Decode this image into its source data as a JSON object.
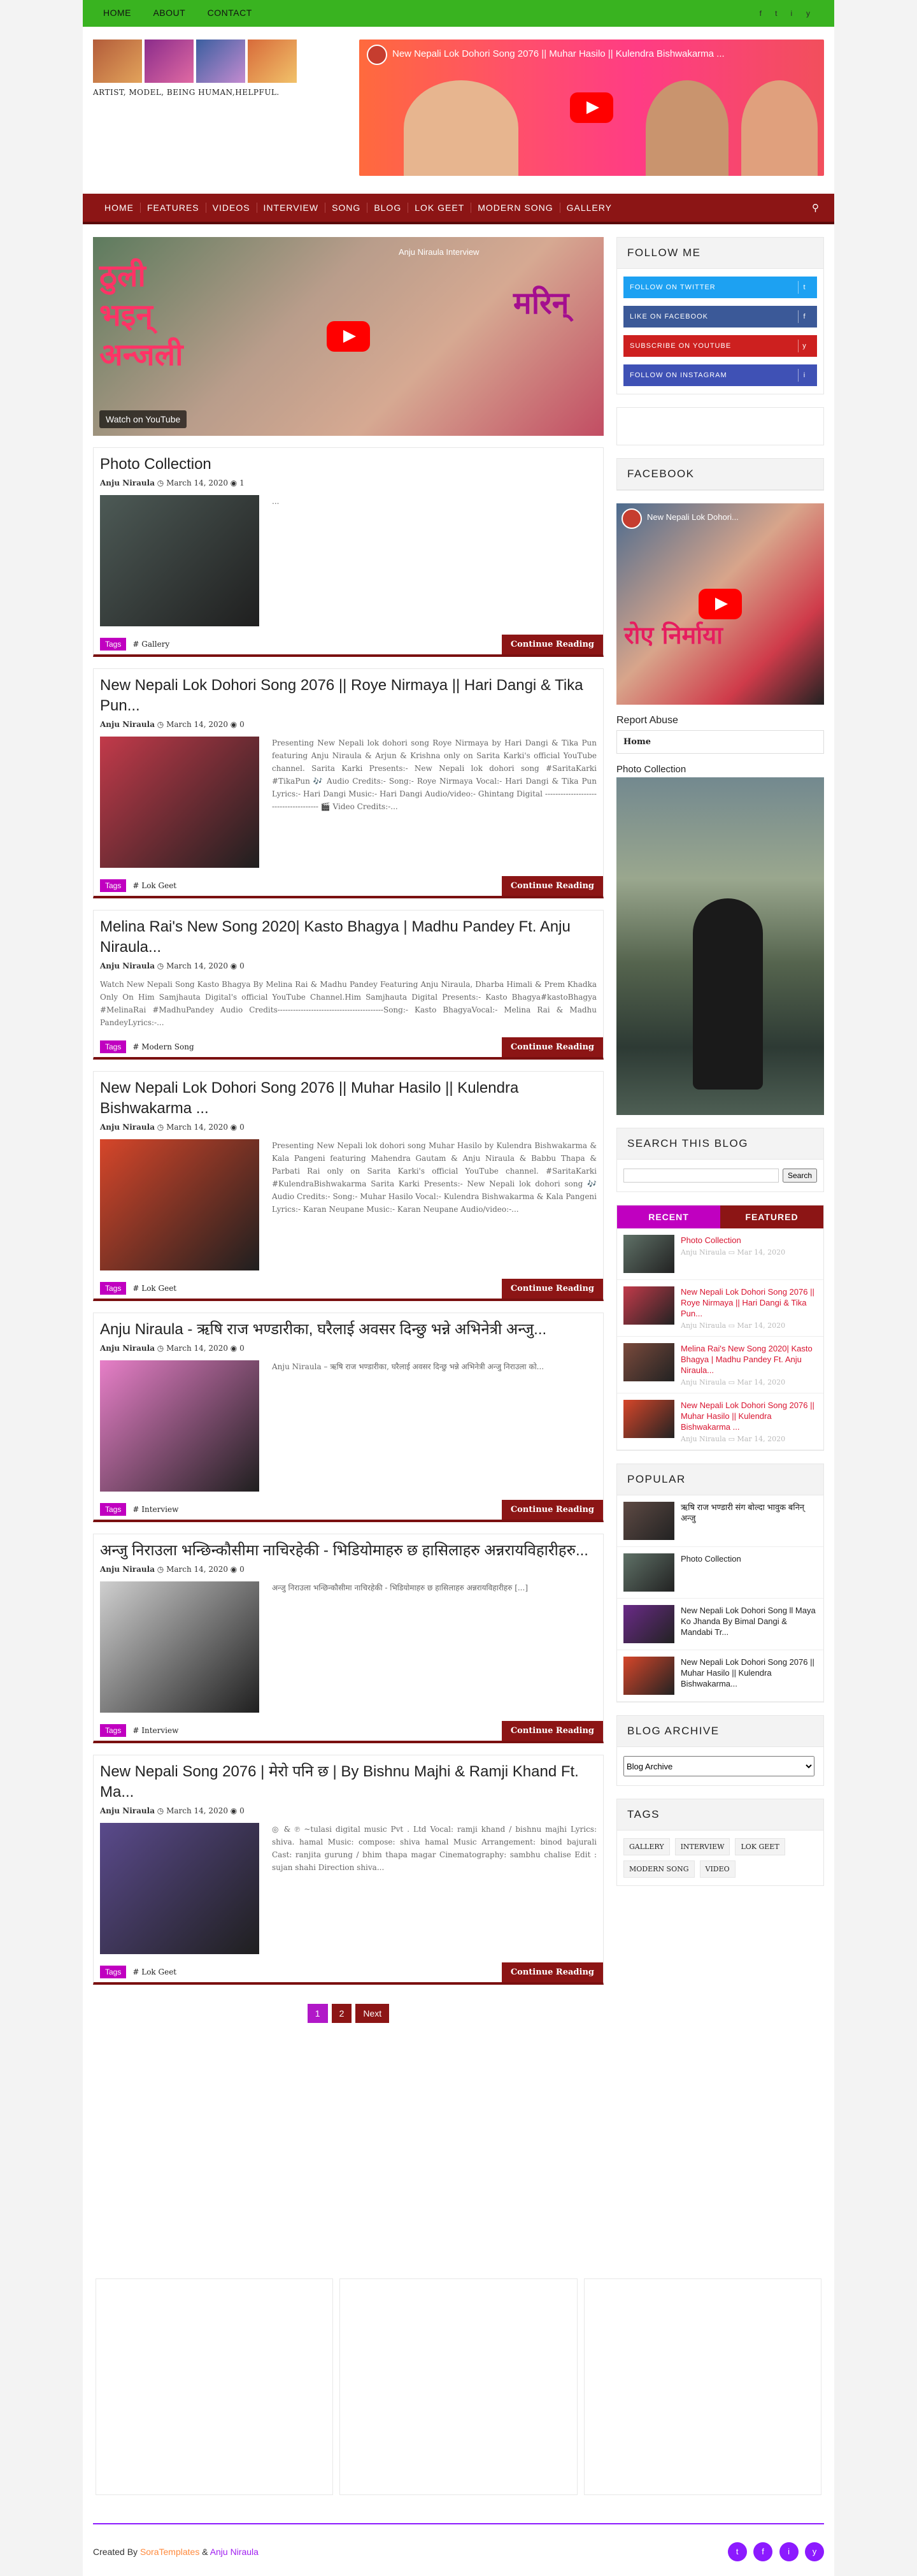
{
  "topnav": {
    "items": [
      "HOME",
      "ABOUT",
      "CONTACT"
    ],
    "social": [
      "f",
      "t",
      "i",
      "y"
    ]
  },
  "header": {
    "tagline": "ARTIST, MODEL, BEING HUMAN,HELPFUL.",
    "video_title": "New Nepali Lok Dohori Song 2076 || Muhar Hasilo || Kulendra Bishwakarma ..."
  },
  "nav": {
    "items": [
      "HOME",
      "FEATURES",
      "VIDEOS",
      "INTERVIEW",
      "SONG",
      "BLOG",
      "LOK GEET",
      "MODERN SONG",
      "GALLERY"
    ]
  },
  "featured": {
    "title": "Anju Niraula Interview",
    "watch": "Watch on  YouTube",
    "text_left": "ठुली भइन् अन्जली",
    "text_right": "मरिन्"
  },
  "posts": [
    {
      "title": "Photo Collection",
      "author": "Anju Niraula",
      "date": "March 14, 2020",
      "comments": "1",
      "snippet": "...",
      "tag": "# Gallery",
      "thumb": "#4d5a56"
    },
    {
      "title": "New Nepali Lok Dohori Song 2076 || Roye Nirmaya || Hari Dangi & Tika Pun...",
      "author": "Anju Niraula",
      "date": "March 14, 2020",
      "comments": "0",
      "snippet": "Presenting New Nepali lok dohori song Roye Nirmaya by Hari Dangi & Tika Pun featuring Anju Niraula & Arjun & Krishna only on Sarita Karki's official YouTube channel. Sarita Karki Presents:- New Nepali lok dohori song #SaritaKarki #TikaPun 🎶 Audio Credits:- Song:- Roye Nirmaya Vocal:- Hari Dangi & Tika Pun Lyrics:- Hari Dangi Music:- Hari Dangi Audio/video:- Ghintang Digital -------------------------------------- 🎬 Video Credits:-...",
      "tag": "# Lok Geet",
      "thumb": "#c23a4a"
    },
    {
      "title": "Melina Rai's New Song 2020| Kasto Bhagya | Madhu Pandey Ft. Anju Niraula...",
      "author": "Anju Niraula",
      "date": "March 14, 2020",
      "comments": "0",
      "snippet": "Watch New Nepali Song Kasto Bhagya By Melina Rai & Madhu Pandey Featuring Anju Niraula, Dharba Himali & Prem Khadka Only On Him Samjhauta Digital's official YouTube Channel.Him Samjhauta Digital Presents:- Kasto Bhagya#kastoBhagya #MelinaRai #MadhuPandey Audio Credits-----------------------------------------Song:- Kasto BhagyaVocal:- Melina Rai & Madhu PandeyLyrics:-...",
      "tag": "# Modern Song",
      "thumb": ""
    },
    {
      "title": "New Nepali Lok Dohori Song 2076 || Muhar Hasilo || Kulendra Bishwakarma ...",
      "author": "Anju Niraula",
      "date": "March 14, 2020",
      "comments": "0",
      "snippet": "Presenting New Nepali lok dohori song Muhar Hasilo by Kulendra Bishwakarma & Kala Pangeni featuring Mahendra Gautam & Anju Niraula & Babbu Thapa & Parbati Rai only on Sarita Karki's official YouTube channel. #SaritaKarki #KulendraBishwakarma Sarita Karki Presents:- New Nepali lok dohori song 🎶 Audio Credits:- Song:- Muhar Hasilo Vocal:- Kulendra Bishwakarma & Kala Pangeni Lyrics:- Karan Neupane Music:- Karan Neupane Audio/video:-...",
      "tag": "# Lok Geet",
      "thumb": "#d6462a"
    },
    {
      "title": "Anju Niraula - ऋषि राज भण्डारीका, घरैलाई अवसर दिन्छु भन्ने अभिनेत्री अन्जु...",
      "author": "Anju Niraula",
      "date": "March 14, 2020",
      "comments": "0",
      "snippet": "Anju Niraula – ऋषि राज भण्डारीका, घरैलाई अवसर दिन्छु भन्ने अभिनेत्री अन्जु निराउला को...",
      "tag": "# Interview",
      "thumb": "#e77fc8"
    },
    {
      "title": "अन्जु निराउला भन्छिन्कौसीमा नाचिरहेकी - भिडियोमाहरु छ हासिलाहरु अन्नरायविहारीहरु...",
      "author": "Anju Niraula",
      "date": "March 14, 2020",
      "comments": "0",
      "snippet": "अन्जु निराउला भन्छिन्कौसीमा नाचिरहेकी - भिडियोमाहरु छ हासिलाहरु अन्नरायविहारीहरु [...]",
      "tag": "# Interview",
      "thumb": "#cfcfcf"
    },
    {
      "title": "New Nepali Song 2076 | मेरो पनि छ | By Bishnu Majhi & Ramji Khand Ft. Ma...",
      "author": "Anju Niraula",
      "date": "March 14, 2020",
      "comments": "0",
      "snippet": "◎ & ℗ ~tulasi digital music Pvt . Ltd Vocal: ramji khand / bishnu majhi Lyrics: shiva. hamal Music: compose: shiva hamal Music Arrangement: binod bajurali Cast: ranjita gurung / bhim thapa magar Cinematography: sambhu chalise Edit : sujan shahi Direction shiva...",
      "tag": "# Lok Geet",
      "thumb": "#5a4a8c"
    }
  ],
  "labels": {
    "tags": "Tags",
    "read_more": "Continue Reading"
  },
  "pager": [
    "1",
    "2",
    "Next"
  ],
  "sidebar": {
    "follow_title": "FOLLOW ME",
    "follow": [
      {
        "label": "FOLLOW ON TWITTER",
        "color": "#1da1f2",
        "icon": "t"
      },
      {
        "label": "LIKE ON FACEBOOK",
        "color": "#3b5998",
        "icon": "f"
      },
      {
        "label": "SUBSCRIBE ON YOUTUBE",
        "color": "#cd201f",
        "icon": "y"
      },
      {
        "label": "FOLLOW ON INSTAGRAM",
        "color": "#3f51b5",
        "icon": "i"
      }
    ],
    "facebook_title": "FACEBOOK",
    "fb_video_title": "New Nepali Lok Dohori...",
    "fb_video_text": "रोए निर्माया",
    "report": "Report Abuse",
    "pages_home": "Home",
    "photo_label": "Photo Collection",
    "search_title": "SEARCH THIS BLOG",
    "search_button": "Search",
    "tab_recent": "RECENT",
    "tab_featured": "FEATURED",
    "recent": [
      {
        "title": "Photo Collection",
        "author": "Anju Niraula",
        "date": "Mar 14, 2020",
        "thumb": "#5f7167"
      },
      {
        "title": "New Nepali Lok Dohori Song 2076 || Roye Nirmaya || Hari Dangi & Tika Pun...",
        "author": "Anju Niraula",
        "date": "Mar 14, 2020",
        "thumb": "#c23a4a"
      },
      {
        "title": "Melina Rai's New Song 2020| Kasto Bhagya | Madhu Pandey Ft. Anju Niraula...",
        "author": "Anju Niraula",
        "date": "Mar 14, 2020",
        "thumb": "#7a4a3c"
      },
      {
        "title": "New Nepali Lok Dohori Song 2076 || Muhar Hasilo || Kulendra Bishwakarma ...",
        "author": "Anju Niraula",
        "date": "Mar 14, 2020",
        "thumb": "#d6462a"
      }
    ],
    "popular_title": "POPULAR",
    "popular": [
      {
        "title": "ऋषि राज भण्डारी संग बोल्दा भावुक बनिन् अन्जु",
        "thumb": "#5e4a44"
      },
      {
        "title": "Photo Collection",
        "thumb": "#5f7167"
      },
      {
        "title": "New Nepali Lok Dohori Song ll Maya Ko Jhanda By Bimal Dangi & Mandabi Tr...",
        "thumb": "#6a2a88"
      },
      {
        "title": "New Nepali Lok Dohori Song 2076 || Muhar Hasilo || Kulendra Bishwakarma...",
        "thumb": "#d6462a"
      }
    ],
    "archive_title": "BLOG ARCHIVE",
    "archive_option": "Blog Archive",
    "tags_title": "TAGS",
    "tagcloud": [
      "GALLERY",
      "INTERVIEW",
      "LOK GEET",
      "MODERN SONG",
      "VIDEO"
    ]
  },
  "footer": {
    "created_by": "Created By",
    "sora": "SoraTemplates",
    "amp": "&",
    "author": "Anju Niraula",
    "icons": [
      "t",
      "f",
      "i",
      "y"
    ]
  }
}
